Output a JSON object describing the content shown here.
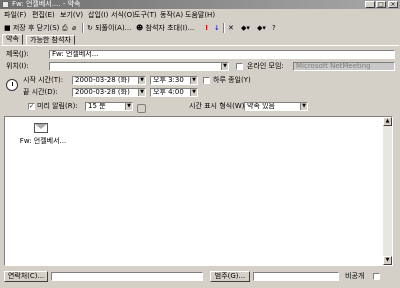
{
  "window": {
    "title": "Fw: 언젤베서.... - 약속"
  },
  "menus": [
    "파일(F)",
    "편집(E)",
    "보기(V)",
    "삽입(I)",
    "서식(O)",
    "도구(T)",
    "동작(A)",
    "도움말(H)"
  ],
  "toolbar": {
    "save_close": "저장 후 닫기(S)",
    "recurrence": "되풀이(A)...",
    "invite": "참석자 초대(I)..."
  },
  "tabs": [
    "약속",
    "가능한 참석자"
  ],
  "form": {
    "subject_label": "제목(J):",
    "subject_value": "Fw: 언젤베서...",
    "location_label": "위치(I):",
    "online_meeting_label": "온라인 모임:",
    "online_meeting_value": "Microsoft NetMeeting",
    "start_label": "시작 시간(T):",
    "start_date": "2000-03-28 (화)",
    "start_time": "오후 3:30",
    "all_day_label": "하루 종일(Y)",
    "end_label": "끝 시간(D):",
    "end_date": "2000-03-28 (화)",
    "end_time": "오후 4:00",
    "reminder_label": "미리 알림(R):",
    "reminder_value": "15 분",
    "showtime_label": "시간 표시 형식(W):",
    "showtime_value": "약속 있음"
  },
  "attachment": {
    "label": "Fw: 언젤베서..."
  },
  "footer": {
    "contacts_button": "연락처(C)...",
    "categories_button": "범주(G)...",
    "private_label": "비공개"
  }
}
